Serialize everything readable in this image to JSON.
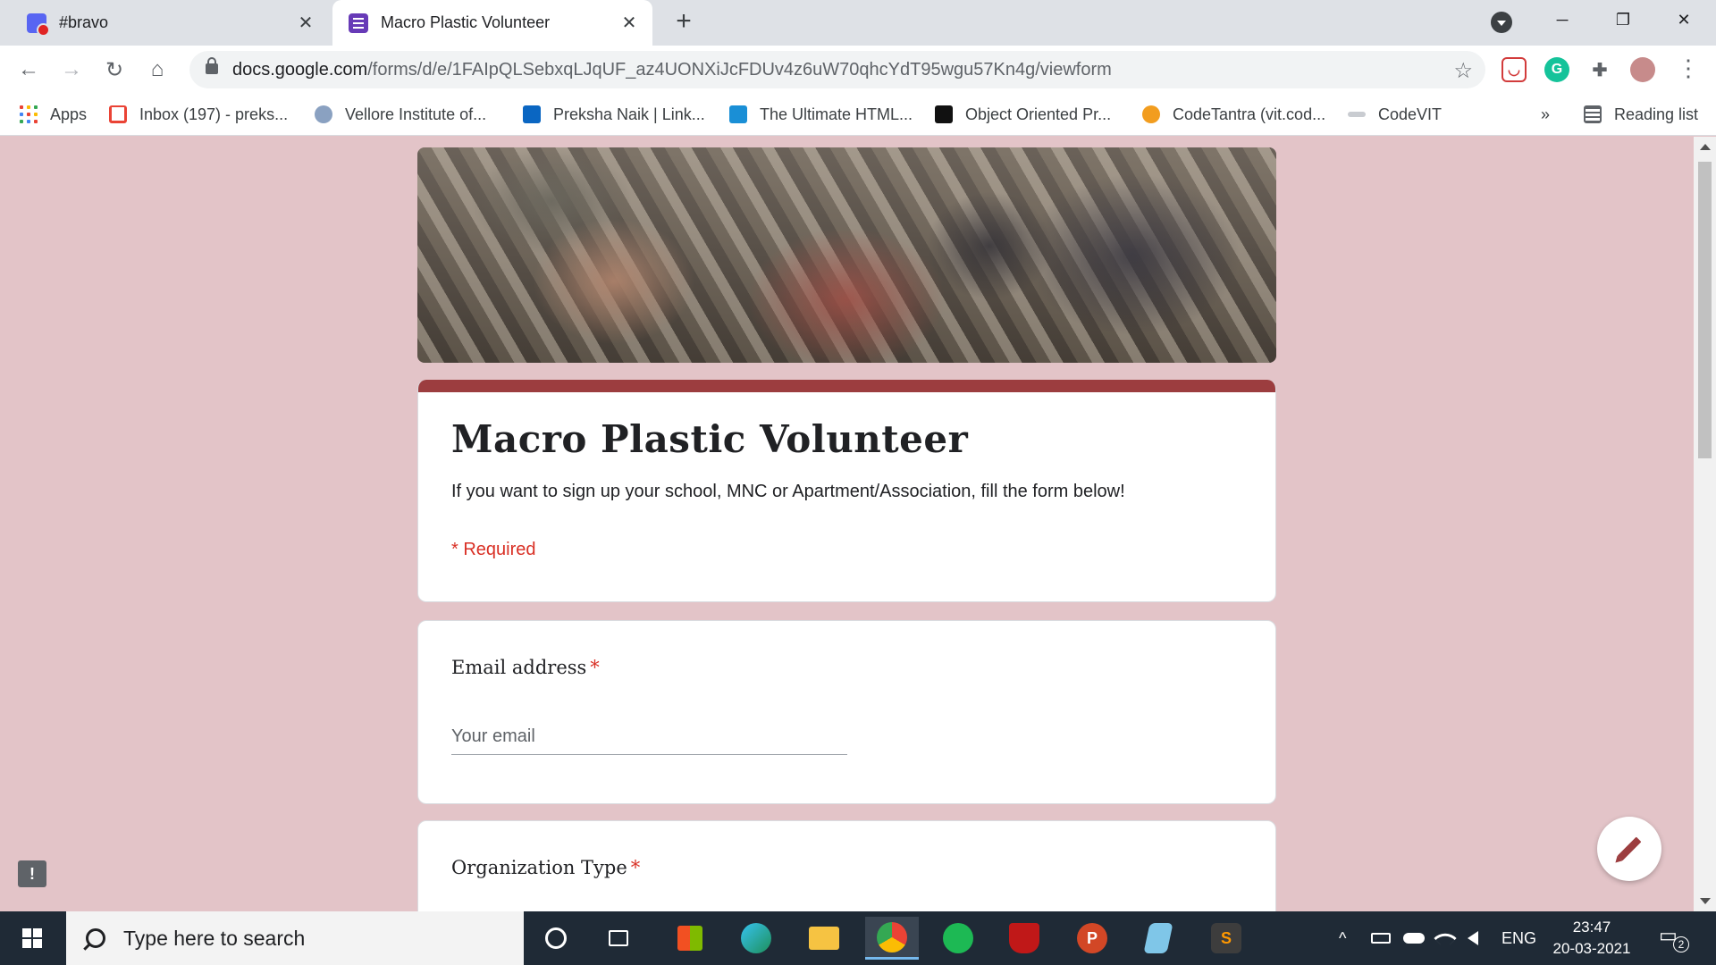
{
  "browser": {
    "tabs": [
      {
        "title": "#bravo",
        "icon": "discord-icon",
        "active": false
      },
      {
        "title": "Macro Plastic Volunteer",
        "icon": "google-forms-icon",
        "active": true
      }
    ],
    "close_glyph": "✕",
    "new_tab_glyph": "+",
    "window_controls": {
      "minimize": "─",
      "restore": "❐",
      "close": "✕"
    },
    "nav": {
      "back": "←",
      "forward": "→",
      "reload": "↻",
      "home": "⌂"
    },
    "url_host": "docs.google.com",
    "url_path": "/forms/d/e/1FAIpQLSebxqLJqUF_az4UONXiJcFDUv4z6uW70qhcYdT95wgu57Kn4g/viewform",
    "star_glyph": "☆",
    "menu_glyph": "⋮"
  },
  "bookmarks": {
    "items": [
      {
        "label": "Apps",
        "icon": "apps-grid-icon"
      },
      {
        "label": "Inbox (197) - preks...",
        "icon": "gmail-icon"
      },
      {
        "label": "Vellore Institute of...",
        "icon": "vit-icon"
      },
      {
        "label": "Preksha Naik | Link...",
        "icon": "linkedin-icon"
      },
      {
        "label": "The Ultimate HTML...",
        "icon": "html-guide-icon"
      },
      {
        "label": "Object Oriented Pr...",
        "icon": "sf-icon"
      },
      {
        "label": "CodeTantra (vit.cod...",
        "icon": "codetantra-icon"
      },
      {
        "label": "CodeVIT",
        "icon": "codevit-icon"
      }
    ],
    "overflow": "»",
    "reading_list": "Reading list"
  },
  "form": {
    "title": "Macro Plastic Volunteer",
    "description": "If you want to sign up your school, MNC or Apartment/Association, fill the form below!",
    "required_note": "* Required",
    "questions": [
      {
        "label": "Email address",
        "required_mark": "*",
        "placeholder": "Your email"
      },
      {
        "label": "Organization Type",
        "required_mark": "*"
      }
    ],
    "accent_color": "#9c3d3f",
    "background_color": "#e3c4c8"
  },
  "feedback_glyph": "!",
  "taskbar": {
    "search_placeholder": "Type here to search",
    "apps": [
      "cortana-icon",
      "task-view-icon",
      "store-icon",
      "edge-icon",
      "file-explorer-icon",
      "chrome-icon",
      "spotify-icon",
      "mcafee-icon",
      "powerpoint-icon",
      "notepad-icon",
      "sublime-icon"
    ],
    "active_app": "chrome-icon",
    "tray": {
      "overflow": "^",
      "language": "ENG",
      "time": "23:47",
      "date": "20-03-2021",
      "notification_count": "2"
    }
  }
}
